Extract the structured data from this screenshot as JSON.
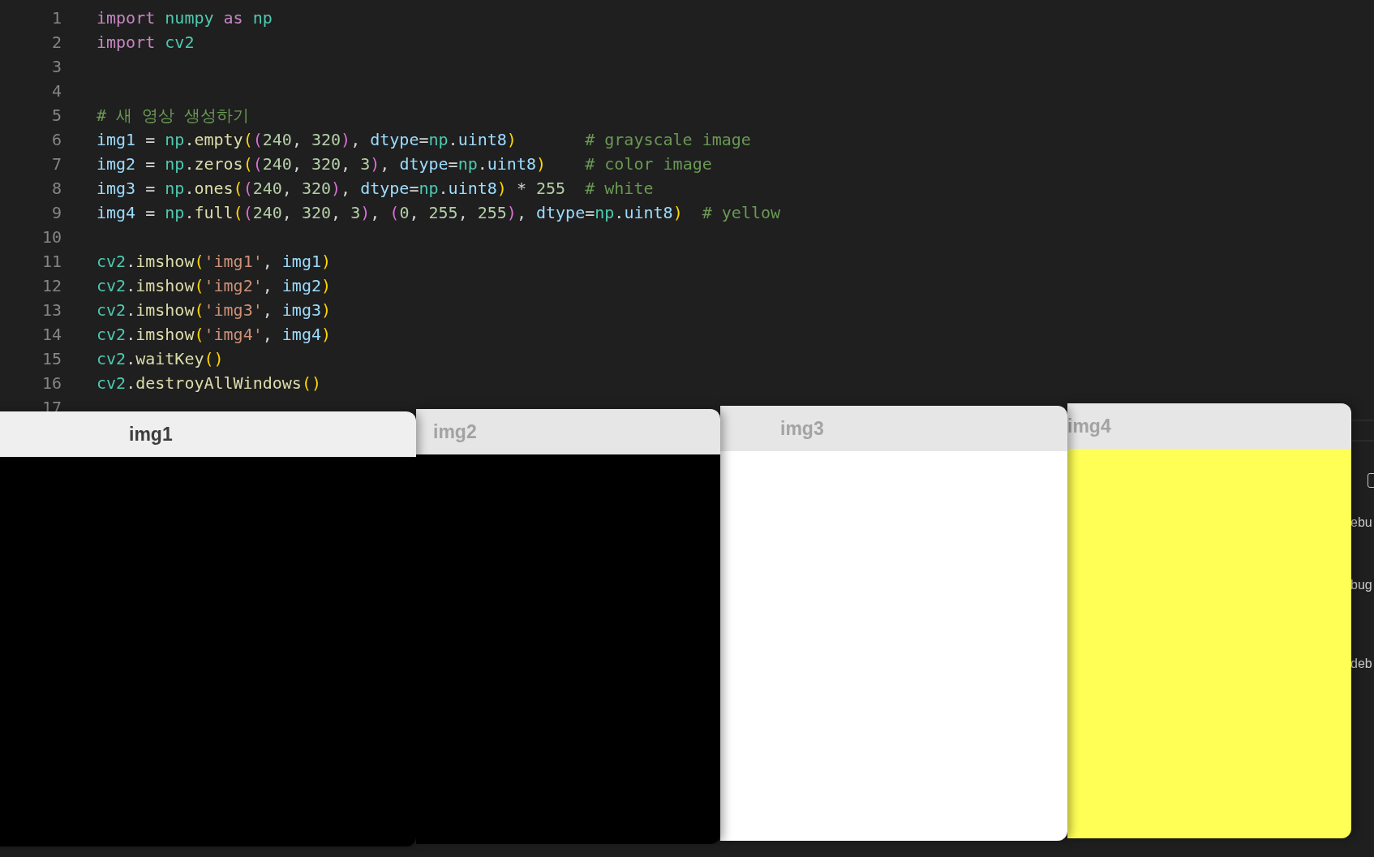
{
  "editor": {
    "lines": [
      {
        "number": "1",
        "tokens": [
          {
            "kind": "keyword",
            "text": "import "
          },
          {
            "kind": "module",
            "text": "numpy "
          },
          {
            "kind": "keyword",
            "text": "as "
          },
          {
            "kind": "module",
            "text": "np"
          }
        ]
      },
      {
        "number": "2",
        "tokens": [
          {
            "kind": "keyword",
            "text": "import "
          },
          {
            "kind": "module",
            "text": "cv2"
          }
        ]
      },
      {
        "number": "3"
      },
      {
        "number": "4"
      },
      {
        "number": "5",
        "tokens": [
          {
            "kind": "comment",
            "text": "# 새 영상 생성하기"
          }
        ]
      },
      {
        "number": "6",
        "tokens": [
          {
            "kind": "variable",
            "text": "img1"
          },
          {
            "kind": "plain",
            "text": " = "
          },
          {
            "kind": "module",
            "text": "np"
          },
          {
            "kind": "plain",
            "text": "."
          },
          {
            "kind": "function",
            "text": "empty"
          },
          {
            "kind": "bracket1",
            "text": "("
          },
          {
            "kind": "bracket2",
            "text": "("
          },
          {
            "kind": "number",
            "text": "240"
          },
          {
            "kind": "plain",
            "text": ", "
          },
          {
            "kind": "number",
            "text": "320"
          },
          {
            "kind": "bracket2",
            "text": ")"
          },
          {
            "kind": "plain",
            "text": ", "
          },
          {
            "kind": "variable",
            "text": "dtype"
          },
          {
            "kind": "plain",
            "text": "="
          },
          {
            "kind": "module",
            "text": "np"
          },
          {
            "kind": "plain",
            "text": "."
          },
          {
            "kind": "variable",
            "text": "uint8"
          },
          {
            "kind": "bracket1",
            "text": ")       "
          },
          {
            "kind": "comment",
            "text": "# grayscale image"
          }
        ]
      },
      {
        "number": "7",
        "tokens": [
          {
            "kind": "variable",
            "text": "img2"
          },
          {
            "kind": "plain",
            "text": " = "
          },
          {
            "kind": "module",
            "text": "np"
          },
          {
            "kind": "plain",
            "text": "."
          },
          {
            "kind": "function",
            "text": "zeros"
          },
          {
            "kind": "bracket1",
            "text": "("
          },
          {
            "kind": "bracket2",
            "text": "("
          },
          {
            "kind": "number",
            "text": "240"
          },
          {
            "kind": "plain",
            "text": ", "
          },
          {
            "kind": "number",
            "text": "320"
          },
          {
            "kind": "plain",
            "text": ", "
          },
          {
            "kind": "number",
            "text": "3"
          },
          {
            "kind": "bracket2",
            "text": ")"
          },
          {
            "kind": "plain",
            "text": ", "
          },
          {
            "kind": "variable",
            "text": "dtype"
          },
          {
            "kind": "plain",
            "text": "="
          },
          {
            "kind": "module",
            "text": "np"
          },
          {
            "kind": "plain",
            "text": "."
          },
          {
            "kind": "variable",
            "text": "uint8"
          },
          {
            "kind": "bracket1",
            "text": ")    "
          },
          {
            "kind": "comment",
            "text": "# color image"
          }
        ]
      },
      {
        "number": "8",
        "tokens": [
          {
            "kind": "variable",
            "text": "img3"
          },
          {
            "kind": "plain",
            "text": " = "
          },
          {
            "kind": "module",
            "text": "np"
          },
          {
            "kind": "plain",
            "text": "."
          },
          {
            "kind": "function",
            "text": "ones"
          },
          {
            "kind": "bracket1",
            "text": "("
          },
          {
            "kind": "bracket2",
            "text": "("
          },
          {
            "kind": "number",
            "text": "240"
          },
          {
            "kind": "plain",
            "text": ", "
          },
          {
            "kind": "number",
            "text": "320"
          },
          {
            "kind": "bracket2",
            "text": ")"
          },
          {
            "kind": "plain",
            "text": ", "
          },
          {
            "kind": "variable",
            "text": "dtype"
          },
          {
            "kind": "plain",
            "text": "="
          },
          {
            "kind": "module",
            "text": "np"
          },
          {
            "kind": "plain",
            "text": "."
          },
          {
            "kind": "variable",
            "text": "uint8"
          },
          {
            "kind": "bracket1",
            "text": ")"
          },
          {
            "kind": "plain",
            "text": " * "
          },
          {
            "kind": "number",
            "text": "255  "
          },
          {
            "kind": "comment",
            "text": "# white"
          }
        ]
      },
      {
        "number": "9",
        "tokens": [
          {
            "kind": "variable",
            "text": "img4"
          },
          {
            "kind": "plain",
            "text": " = "
          },
          {
            "kind": "module",
            "text": "np"
          },
          {
            "kind": "plain",
            "text": "."
          },
          {
            "kind": "function",
            "text": "full"
          },
          {
            "kind": "bracket1",
            "text": "("
          },
          {
            "kind": "bracket2",
            "text": "("
          },
          {
            "kind": "number",
            "text": "240"
          },
          {
            "kind": "plain",
            "text": ", "
          },
          {
            "kind": "number",
            "text": "320"
          },
          {
            "kind": "plain",
            "text": ", "
          },
          {
            "kind": "number",
            "text": "3"
          },
          {
            "kind": "bracket2",
            "text": ")"
          },
          {
            "kind": "plain",
            "text": ", "
          },
          {
            "kind": "bracket2",
            "text": "("
          },
          {
            "kind": "number",
            "text": "0"
          },
          {
            "kind": "plain",
            "text": ", "
          },
          {
            "kind": "number",
            "text": "255"
          },
          {
            "kind": "plain",
            "text": ", "
          },
          {
            "kind": "number",
            "text": "255"
          },
          {
            "kind": "bracket2",
            "text": ")"
          },
          {
            "kind": "plain",
            "text": ", "
          },
          {
            "kind": "variable",
            "text": "dtype"
          },
          {
            "kind": "plain",
            "text": "="
          },
          {
            "kind": "module",
            "text": "np"
          },
          {
            "kind": "plain",
            "text": "."
          },
          {
            "kind": "variable",
            "text": "uint8"
          },
          {
            "kind": "bracket1",
            "text": ")  "
          },
          {
            "kind": "comment",
            "text": "# yellow"
          }
        ]
      },
      {
        "number": "10"
      },
      {
        "number": "11",
        "tokens": [
          {
            "kind": "module",
            "text": "cv2"
          },
          {
            "kind": "plain",
            "text": "."
          },
          {
            "kind": "function",
            "text": "imshow"
          },
          {
            "kind": "bracket1",
            "text": "("
          },
          {
            "kind": "string",
            "text": "'img1'"
          },
          {
            "kind": "plain",
            "text": ", "
          },
          {
            "kind": "variable",
            "text": "img1"
          },
          {
            "kind": "bracket1",
            "text": ")"
          }
        ]
      },
      {
        "number": "12",
        "tokens": [
          {
            "kind": "module",
            "text": "cv2"
          },
          {
            "kind": "plain",
            "text": "."
          },
          {
            "kind": "function",
            "text": "imshow"
          },
          {
            "kind": "bracket1",
            "text": "("
          },
          {
            "kind": "string",
            "text": "'img2'"
          },
          {
            "kind": "plain",
            "text": ", "
          },
          {
            "kind": "variable",
            "text": "img2"
          },
          {
            "kind": "bracket1",
            "text": ")"
          }
        ]
      },
      {
        "number": "13",
        "tokens": [
          {
            "kind": "module",
            "text": "cv2"
          },
          {
            "kind": "plain",
            "text": "."
          },
          {
            "kind": "function",
            "text": "imshow"
          },
          {
            "kind": "bracket1",
            "text": "("
          },
          {
            "kind": "string",
            "text": "'img3'"
          },
          {
            "kind": "plain",
            "text": ", "
          },
          {
            "kind": "variable",
            "text": "img3"
          },
          {
            "kind": "bracket1",
            "text": ")"
          }
        ]
      },
      {
        "number": "14",
        "tokens": [
          {
            "kind": "module",
            "text": "cv2"
          },
          {
            "kind": "plain",
            "text": "."
          },
          {
            "kind": "function",
            "text": "imshow"
          },
          {
            "kind": "bracket1",
            "text": "("
          },
          {
            "kind": "string",
            "text": "'img4'"
          },
          {
            "kind": "plain",
            "text": ", "
          },
          {
            "kind": "variable",
            "text": "img4"
          },
          {
            "kind": "bracket1",
            "text": ")"
          }
        ]
      },
      {
        "number": "15",
        "tokens": [
          {
            "kind": "module",
            "text": "cv2"
          },
          {
            "kind": "plain",
            "text": "."
          },
          {
            "kind": "function",
            "text": "waitKey"
          },
          {
            "kind": "bracket1",
            "text": "()"
          }
        ]
      },
      {
        "number": "16",
        "tokens": [
          {
            "kind": "module",
            "text": "cv2"
          },
          {
            "kind": "plain",
            "text": "."
          },
          {
            "kind": "function",
            "text": "destroyAllWindows"
          },
          {
            "kind": "bracket1",
            "text": "()"
          }
        ]
      },
      {
        "number": "17"
      }
    ]
  },
  "side_panel": {
    "checkbox": {
      "checked": false
    },
    "texts": [
      "ebu",
      "bug",
      "deb"
    ]
  },
  "windows": [
    {
      "title": "img1",
      "active": true,
      "color": "#000000"
    },
    {
      "title": "img2",
      "active": false,
      "color": "#000000"
    },
    {
      "title": "img3",
      "active": false,
      "color": "#ffffff"
    },
    {
      "title": "img4",
      "active": false,
      "color": "#ffff55"
    }
  ]
}
